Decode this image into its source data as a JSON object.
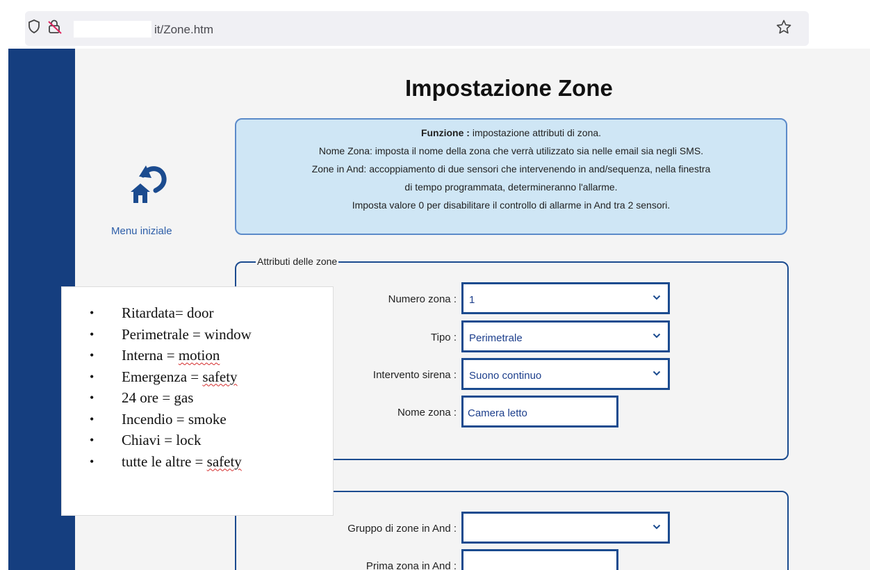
{
  "browser": {
    "url_visible": "it/Zone.htm"
  },
  "sidebar": {
    "home_label": "Menu iniziale"
  },
  "page": {
    "title": "Impostazione Zone",
    "info": {
      "line1_bold": "Funzione :",
      "line1_rest": " impostazione attributi di zona.",
      "line2": "Nome Zona: imposta il nome della zona che verrà utilizzato sia nelle email sia negli SMS.",
      "line3": "Zone in And: accoppiamento di due sensori che intervenendo in and/sequenza, nella finestra",
      "line4": "di tempo programmata, determineranno l'allarme.",
      "line5": "Imposta valore 0 per disabilitare il controllo di allarme in And tra 2 sensori."
    },
    "zone_attributes": {
      "legend": "Attributi delle zone",
      "numero_zona_label": "Numero zona :",
      "numero_zona_value": "1",
      "tipo_label": "Tipo :",
      "tipo_value": "Perimetrale",
      "sirena_label": "Intervento sirena :",
      "sirena_value": "Suono continuo",
      "nome_label": "Nome zona :",
      "nome_value": "Camera letto"
    },
    "and_zones": {
      "gruppo_label": "Gruppo di zone in And :",
      "gruppo_value": "",
      "prima_label": "Prima zona in And :",
      "prima_value": ""
    }
  },
  "note": {
    "items": [
      "Ritardata= door",
      "Perimetrale = window",
      "Interna = motion",
      "Emergenza = safety",
      "24 ore = gas",
      "Incendio = smoke",
      "Chiavi = lock",
      "tutte le altre = safety"
    ]
  },
  "colors": {
    "sidebar": "#153e7f",
    "accent": "#1b4b8f",
    "info_bg": "#cfe6f5"
  }
}
